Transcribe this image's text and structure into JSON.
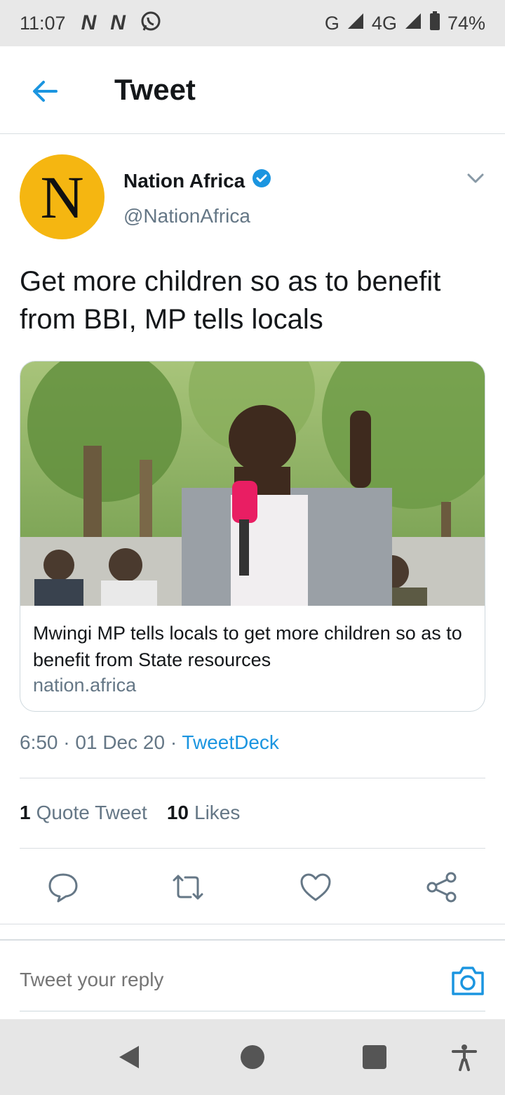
{
  "status_bar": {
    "time": "11:07",
    "network_g": "G",
    "network_4g": "4G",
    "battery": "74%"
  },
  "header": {
    "title": "Tweet"
  },
  "tweet": {
    "author_initial": "N",
    "author_name": "Nation Africa",
    "author_handle": "@NationAfrica",
    "text": "Get more children so as to benefit from BBI, MP tells locals",
    "card": {
      "title": "Mwingi MP tells locals to get more children so as to benefit from State resources",
      "domain": "nation.africa"
    },
    "time": "6:50",
    "date": "01 Dec 20",
    "source": "TweetDeck",
    "quote_count": "1",
    "quote_label": "Quote Tweet",
    "like_count": "10",
    "like_label": "Likes"
  },
  "reply": {
    "placeholder": "Tweet your reply"
  },
  "colors": {
    "accent": "#1b95e0",
    "avatar_bg": "#f5b611",
    "secondary_text": "#657786"
  }
}
